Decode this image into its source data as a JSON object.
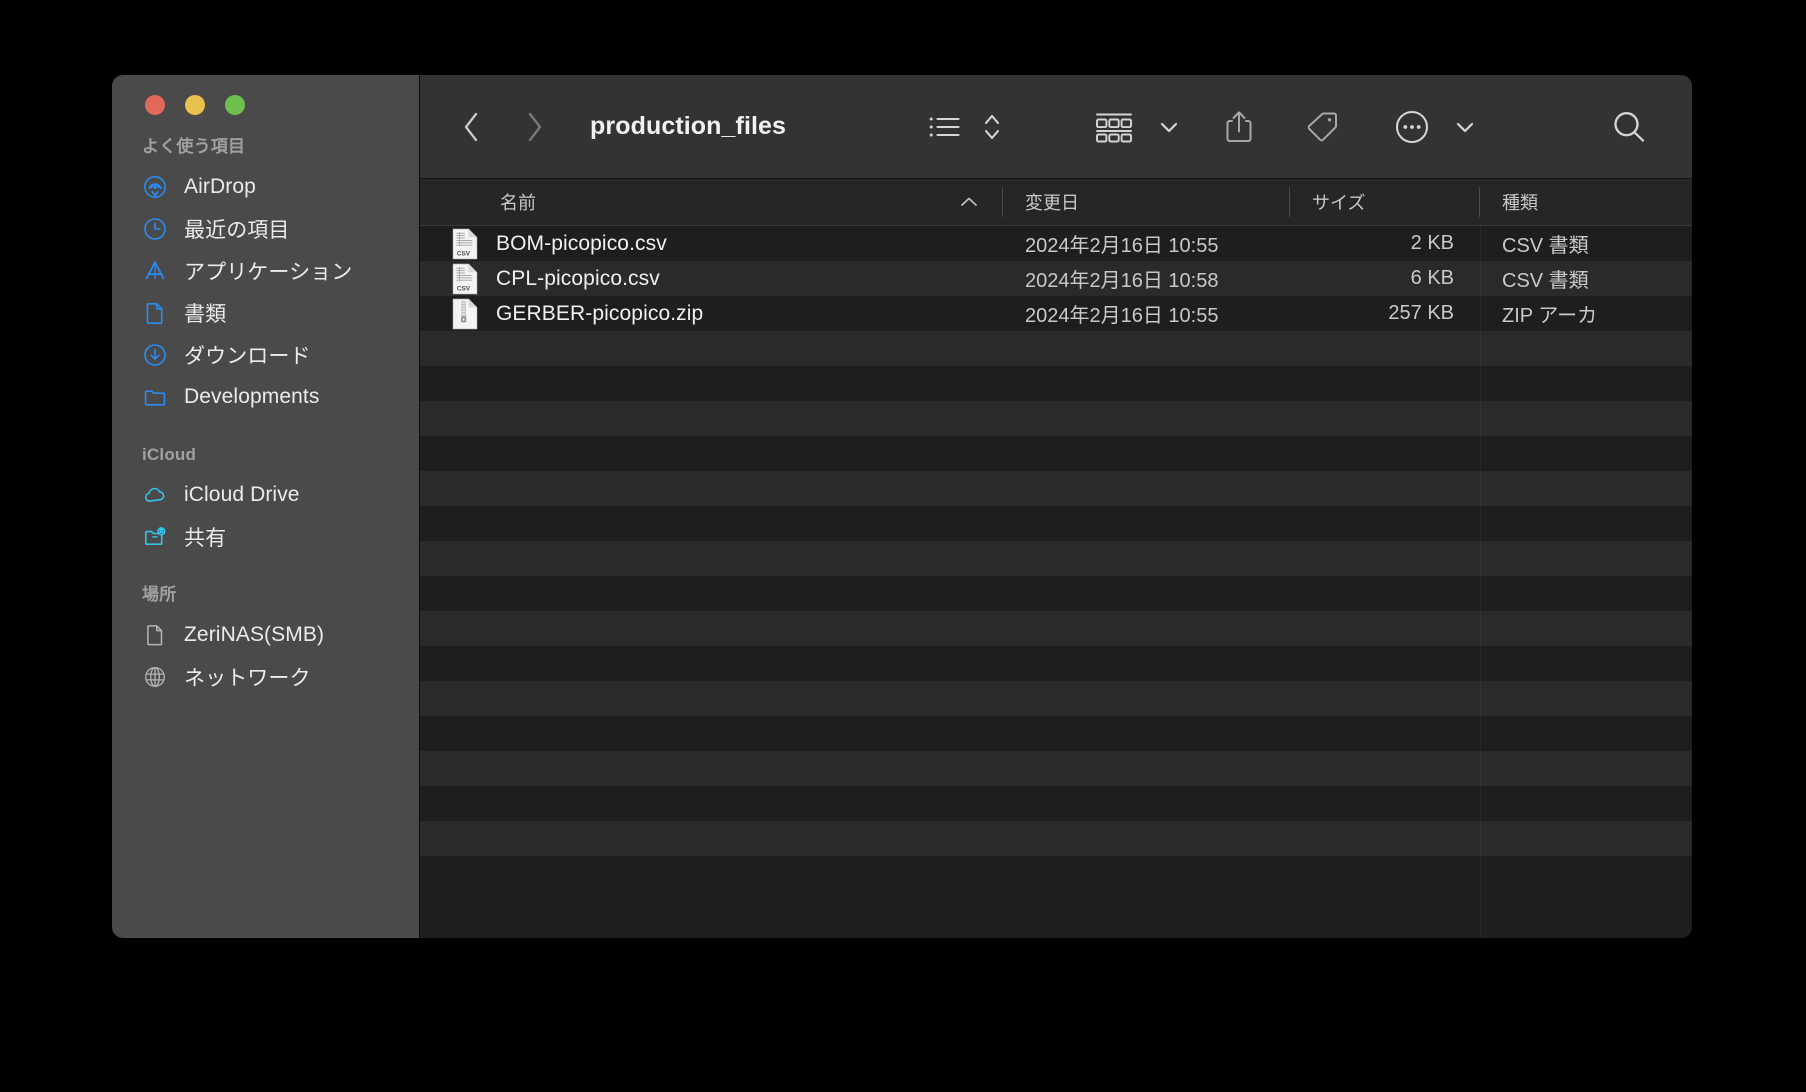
{
  "window": {
    "title": "production_files",
    "traffic_lights": [
      {
        "name": "close",
        "color": "#e0695a"
      },
      {
        "name": "minimize",
        "color": "#e8c24c"
      },
      {
        "name": "maximize",
        "color": "#6fbf4f"
      }
    ]
  },
  "toolbar": {
    "back_label": "戻る",
    "forward_label": "進む",
    "view_list_label": "リスト表示",
    "arrange_label": "グループ分け",
    "share_label": "共有",
    "tags_label": "タグ",
    "more_label": "その他",
    "search_label": "検索",
    "icons": {
      "back": "chevron-left-icon",
      "forward": "chevron-right-icon",
      "view_list": "list-view-icon",
      "view_sort": "updown-chevrons-icon",
      "group": "grid-group-icon",
      "group_caret": "chevron-down-icon",
      "share": "share-upload-icon",
      "tag": "tag-icon",
      "more": "ellipsis-circle-icon",
      "more_caret": "chevron-down-icon",
      "search": "search-icon"
    }
  },
  "sidebar": {
    "sections": [
      {
        "title": "よく使う項目",
        "items": [
          {
            "label": "AirDrop",
            "icon": "airdrop-icon",
            "color": "#2a8cf0"
          },
          {
            "label": "最近の項目",
            "icon": "clock-icon",
            "color": "#2a8cf0"
          },
          {
            "label": "アプリケーション",
            "icon": "applications-icon",
            "color": "#2a8cf0"
          },
          {
            "label": "書類",
            "icon": "document-icon",
            "color": "#2a8cf0"
          },
          {
            "label": "ダウンロード",
            "icon": "download-circle-icon",
            "color": "#2a8cf0"
          },
          {
            "label": "Developments",
            "icon": "folder-icon",
            "color": "#2a8cf0"
          }
        ]
      },
      {
        "title": "iCloud",
        "items": [
          {
            "label": "iCloud Drive",
            "icon": "cloud-icon",
            "color": "#35c2e8"
          },
          {
            "label": "共有",
            "icon": "shared-folder-icon",
            "color": "#35c2e8"
          }
        ]
      },
      {
        "title": "場所",
        "items": [
          {
            "label": "ZeriNAS(SMB)",
            "icon": "document-icon",
            "color": "#b5b5b5"
          },
          {
            "label": "ネットワーク",
            "icon": "globe-icon",
            "color": "#b5b5b5"
          }
        ]
      }
    ]
  },
  "columns": {
    "name": "名前",
    "date_modified": "変更日",
    "size": "サイズ",
    "kind": "種類",
    "sort_indicator": "chevron-up-icon"
  },
  "files": [
    {
      "name": "BOM-picopico.csv",
      "date_modified": "2024年2月16日 10:55",
      "size": "2 KB",
      "kind": "CSV 書類",
      "icon": "csv-file-icon"
    },
    {
      "name": "CPL-picopico.csv",
      "date_modified": "2024年2月16日 10:58",
      "size": "6 KB",
      "kind": "CSV 書類",
      "icon": "csv-file-icon"
    },
    {
      "name": "GERBER-picopico.zip",
      "date_modified": "2024年2月16日 10:55",
      "size": "257 KB",
      "kind": "ZIP アーカ",
      "icon": "zip-file-icon"
    }
  ],
  "empty_rows_count": 15,
  "colors": {
    "window_bg": "#1e1e1e",
    "sidebar_bg": "#4a4a4a",
    "toolbar_bg": "#333333",
    "header_bg": "#262626",
    "row_alt": "#2a2a2a",
    "accent_blue": "#2a8cf0",
    "accent_cyan": "#35c2e8",
    "text_primary": "#f0f0f0",
    "text_secondary": "#c9c9c9",
    "text_muted": "#a0a0a0"
  }
}
